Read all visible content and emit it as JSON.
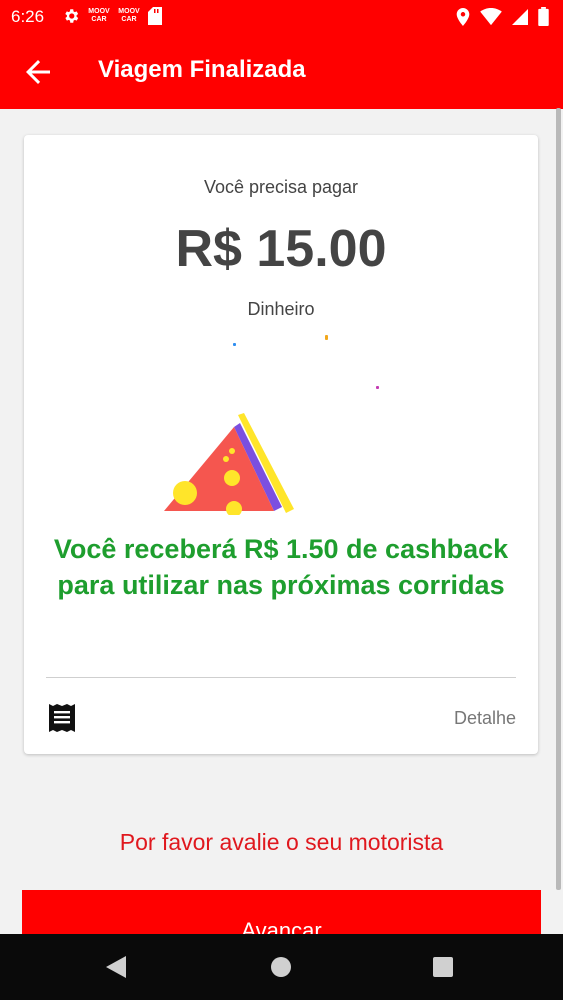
{
  "status_bar": {
    "time": "6:26",
    "brand_badge_1": "MOOV\nCAR",
    "brand_badge_2": "MOOV\nCAR",
    "icons": [
      "settings-icon",
      "moov-badge",
      "moov-badge",
      "sd-card-icon",
      "location-icon",
      "wifi-icon",
      "signal-icon",
      "battery-icon"
    ]
  },
  "app_bar": {
    "title": "Viagem Finalizada",
    "back_icon": "arrow-left-icon"
  },
  "card": {
    "pay_label": "Você precisa pagar",
    "amount": "R$ 15.00",
    "payment_method": "Dinheiro",
    "cashback_message": "Você receberá R$ 1.50 de cashback para utilizar nas próximas corridas",
    "receipt_icon": "receipt-icon",
    "detail_label": "Detalhe"
  },
  "rate_driver_label": "Por favor avalie o seu motorista",
  "next_button_label": "Avançar",
  "colors": {
    "primary_red": "#ff0000",
    "cashback_green": "#1e9e2e",
    "rate_red": "#e0181e"
  }
}
